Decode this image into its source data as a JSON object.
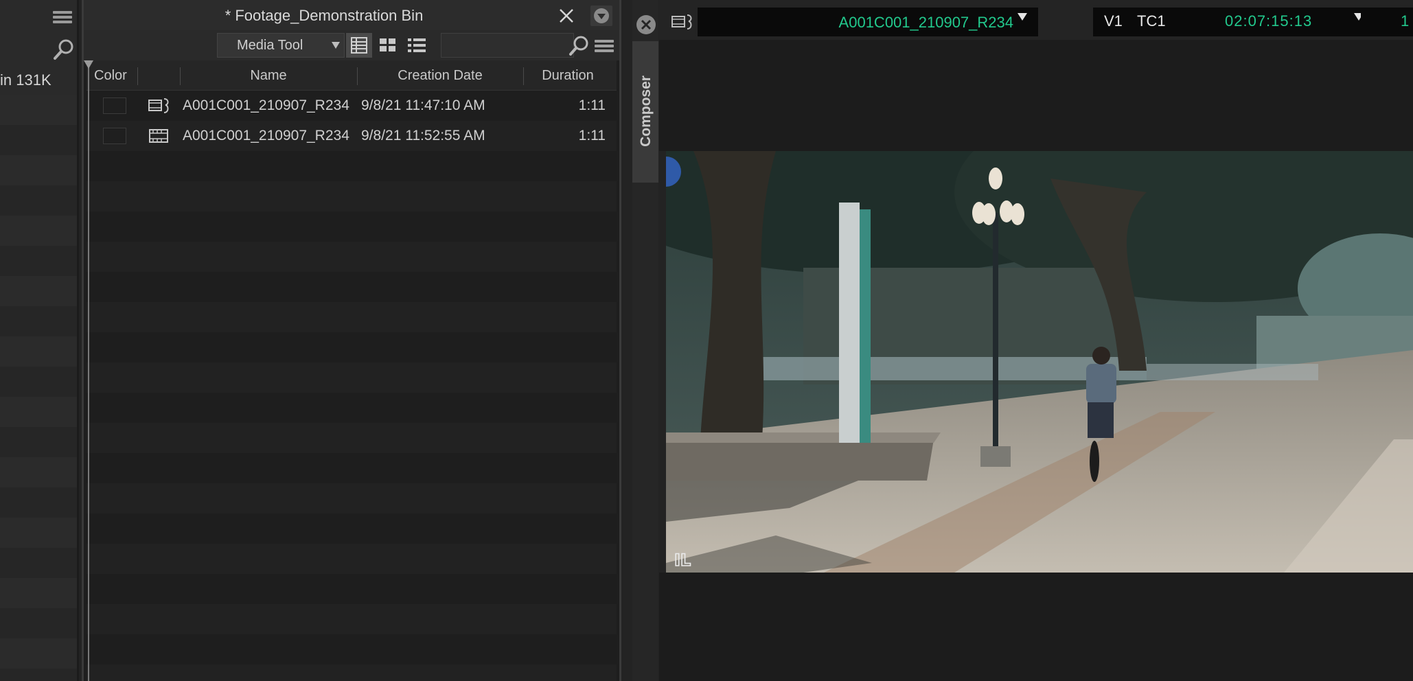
{
  "left_panel": {
    "partial_text": "in   131K",
    "icons": {
      "menu": "hamburger-icon",
      "search": "search-icon"
    }
  },
  "bin": {
    "title": "* Footage_Demonstration Bin",
    "toolbar": {
      "view_selector": "Media Tool",
      "views": [
        "frame-view-icon",
        "script-view-icon",
        "text-view-icon"
      ]
    },
    "columns": [
      "Color",
      "Name",
      "Creation Date",
      "Duration"
    ],
    "rows": [
      {
        "icon": "subclip-icon",
        "name": "A001C001_210907_R234",
        "creation_date": "9/8/21 11:47:10 AM",
        "duration": "1:11"
      },
      {
        "icon": "master-clip-icon",
        "name": "A001C001_210907_R234",
        "creation_date": "9/8/21 11:52:55 AM",
        "duration": "1:11"
      }
    ]
  },
  "composer": {
    "tab_label": "Composer",
    "clip_name": "A001C001_210907_R234",
    "track": "V1",
    "timecode_type": "TC1",
    "timecode": "02:07:15:13",
    "cut_off_timecode": "1",
    "overlay_icon": "IL",
    "colors": {
      "timecode_green": "#22c98d",
      "field_bg": "#0a0a0a"
    }
  }
}
